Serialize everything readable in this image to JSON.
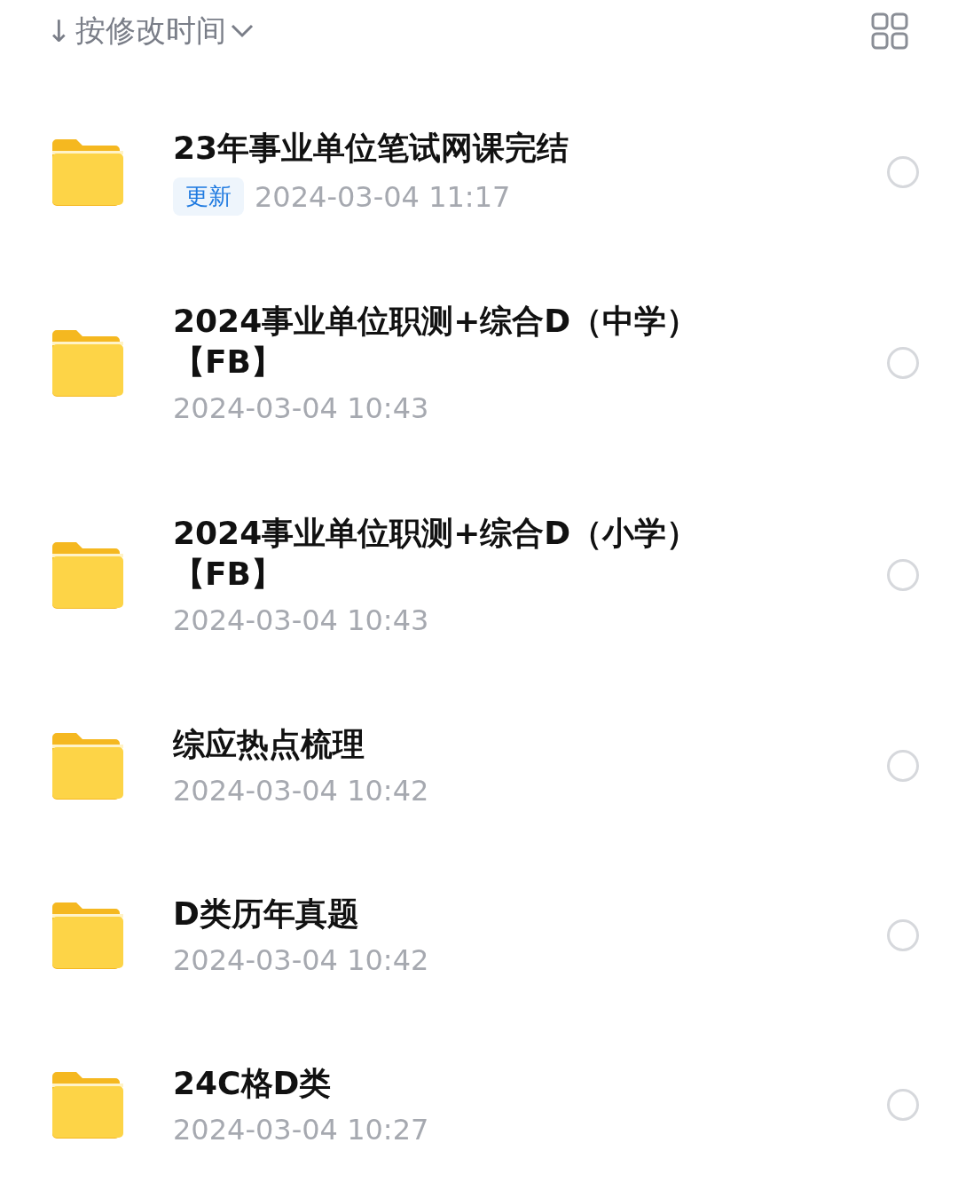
{
  "header": {
    "sort_arrow": "↓",
    "sort_label": "按修改时间"
  },
  "folders": [
    {
      "name": "23年事业单位笔试网课完结",
      "badge": "更新",
      "date": "2024-03-04 11:17",
      "selected": false
    },
    {
      "name": "2024事业单位职测+综合D（中学）【FB】",
      "date": "2024-03-04 10:43",
      "selected": false
    },
    {
      "name": "2024事业单位职测+综合D（小学）【FB】",
      "date": "2024-03-04 10:43",
      "selected": false
    },
    {
      "name": "综应热点梳理",
      "date": "2024-03-04 10:42",
      "selected": false
    },
    {
      "name": "D类历年真题",
      "date": "2024-03-04 10:42",
      "selected": false
    },
    {
      "name": "24C格D类",
      "date": "2024-03-04 10:27",
      "selected": false
    }
  ]
}
